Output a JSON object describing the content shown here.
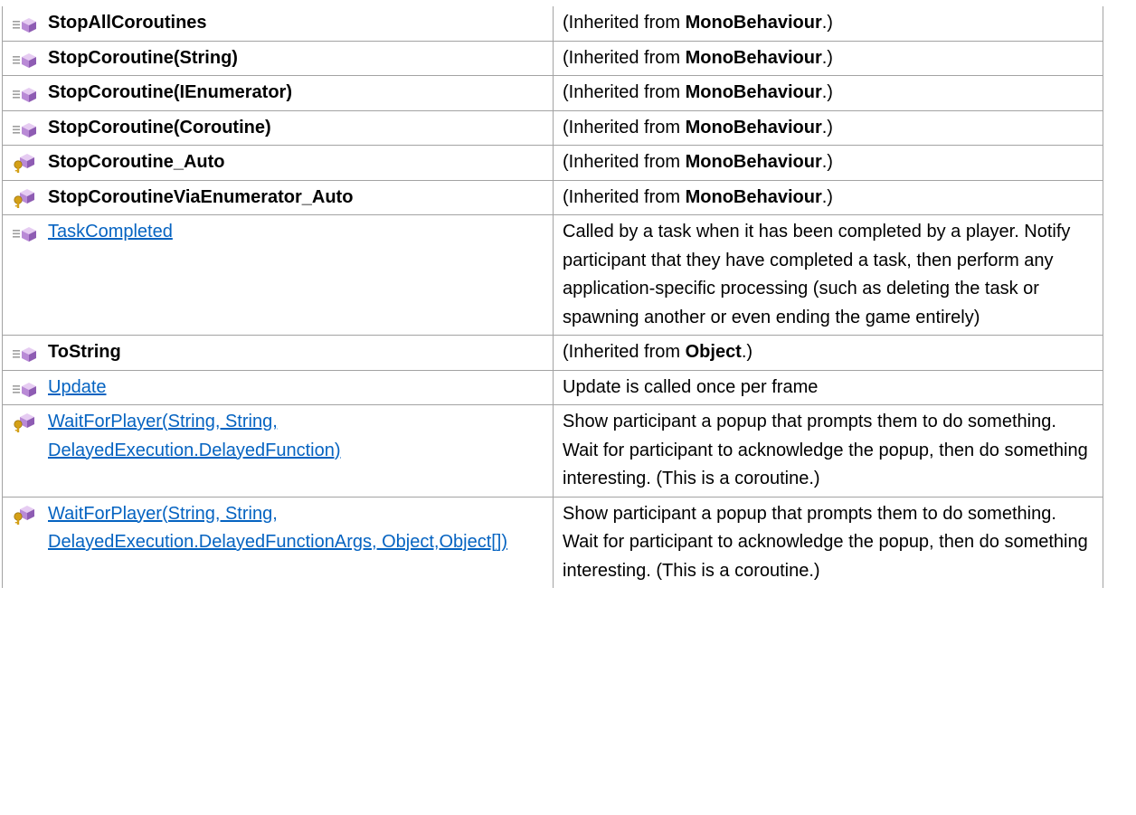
{
  "colors": {
    "border": "#a3a3a3",
    "link": "#0563c1",
    "method_icon_purple": "#b98ad6",
    "method_icon_lines": "#9e9e9e",
    "protected_key_gold": "#d4a017"
  },
  "rows": [
    {
      "icon": "public-method-icon",
      "name": "StopAllCoroutines",
      "link": false,
      "desc": {
        "prefix": " (Inherited from ",
        "bold": "MonoBehaviour",
        "suffix": ".)"
      }
    },
    {
      "icon": "public-method-icon",
      "name": "StopCoroutine(String)",
      "link": false,
      "desc": {
        "prefix": " (Inherited from ",
        "bold": "MonoBehaviour",
        "suffix": ".)"
      }
    },
    {
      "icon": "public-method-icon",
      "name": "StopCoroutine(IEnumerator)",
      "link": false,
      "desc": {
        "prefix": " (Inherited from ",
        "bold": "MonoBehaviour",
        "suffix": ".)"
      }
    },
    {
      "icon": "public-method-icon",
      "name": "StopCoroutine(Coroutine)",
      "link": false,
      "desc": {
        "prefix": " (Inherited from ",
        "bold": "MonoBehaviour",
        "suffix": ".)"
      }
    },
    {
      "icon": "protected-method-icon",
      "name": "StopCoroutine_Auto",
      "link": false,
      "desc": {
        "prefix": " (Inherited from ",
        "bold": "MonoBehaviour",
        "suffix": ".)"
      }
    },
    {
      "icon": "protected-method-icon",
      "name": "StopCoroutineViaEnumerator_Auto",
      "link": false,
      "desc": {
        "prefix": " (Inherited from ",
        "bold": "MonoBehaviour",
        "suffix": ".)"
      }
    },
    {
      "icon": "public-method-icon",
      "name": "TaskCompleted",
      "link": true,
      "desc": {
        "text": "Called by a task when it has been completed by a player. Notify participant that they have completed a task, then perform any application-specific processing (such as deleting the task or spawning another or even ending the game entirely)"
      }
    },
    {
      "icon": "public-method-icon",
      "name": "ToString",
      "link": false,
      "desc": {
        "prefix": " (Inherited from ",
        "bold": "Object",
        "suffix": ".)"
      }
    },
    {
      "icon": "public-method-icon",
      "name": "Update",
      "link": true,
      "desc": {
        "text": "Update is called once per frame"
      }
    },
    {
      "icon": "protected-method-icon",
      "name": "WaitForPlayer(String, String, DelayedExecution.DelayedFunction)",
      "link": true,
      "desc": {
        "text": "Show participant a popup that prompts them to do something. Wait for participant to acknowledge the popup, then do something interesting. (This is a coroutine.)"
      }
    },
    {
      "icon": "protected-method-icon",
      "name": "WaitForPlayer(String, String, DelayedExecution.DelayedFunctionArgs, Object,Object[])",
      "link": true,
      "desc": {
        "text": "Show participant a popup that prompts them to do something. Wait for participant to acknowledge the popup, then do something interesting. (This is a coroutine.)"
      }
    }
  ]
}
